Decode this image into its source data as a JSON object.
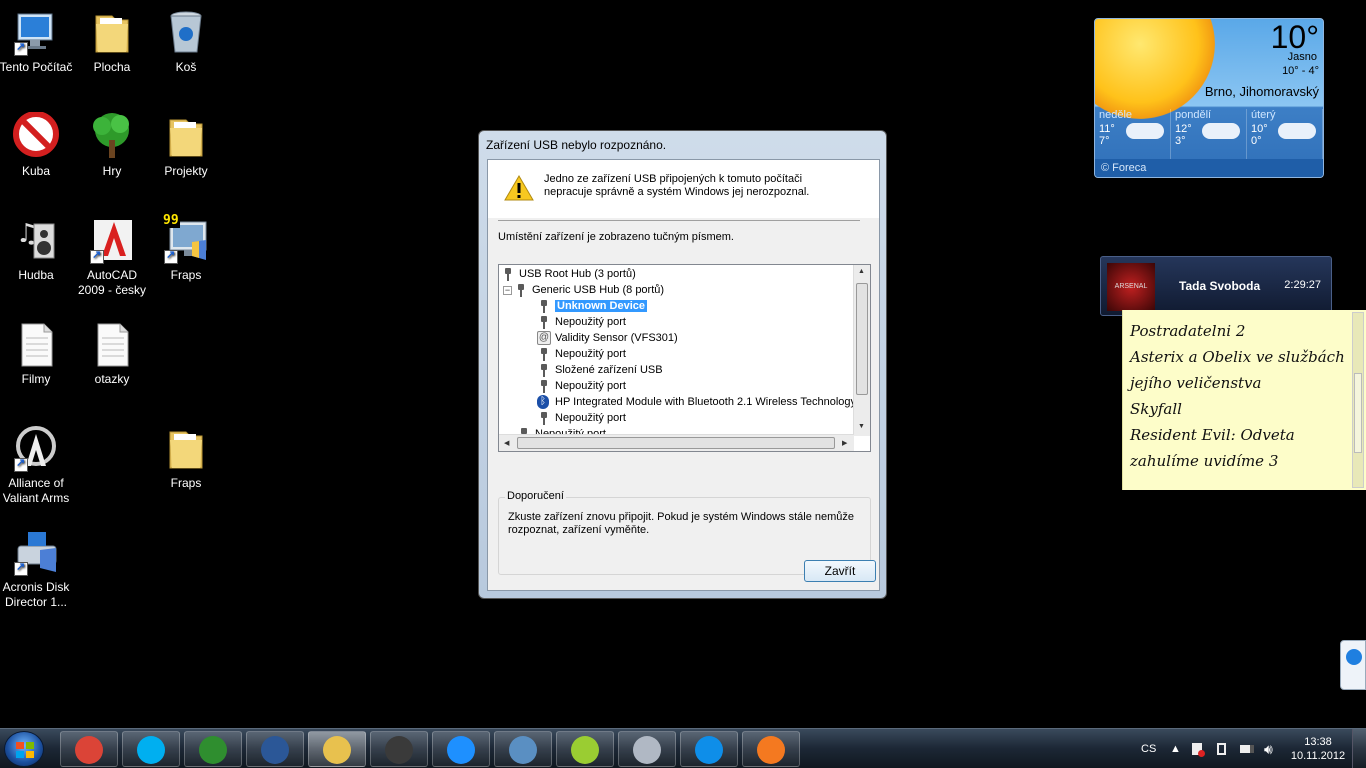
{
  "desktop": {
    "icons": [
      {
        "label": "Tento Počítač",
        "icon": "computer-icon"
      },
      {
        "label": "Plocha",
        "icon": "folder-icon"
      },
      {
        "label": "Koš",
        "icon": "recycle-bin-icon"
      },
      {
        "label": "Kuba",
        "icon": "no-entry-icon"
      },
      {
        "label": "Hry",
        "icon": "tree-icon"
      },
      {
        "label": "Projekty",
        "icon": "folder-icon"
      },
      {
        "label": "Hudba",
        "icon": "music-icon"
      },
      {
        "label": "AutoCAD 2009 - česky",
        "icon": "autocad-icon"
      },
      {
        "label": "Fraps",
        "icon": "fraps-icon"
      },
      {
        "label": "Filmy",
        "icon": "document-icon"
      },
      {
        "label": "otazky",
        "icon": "document-icon"
      },
      {
        "label": "Alliance of Valiant Arms",
        "icon": "ava-icon"
      },
      {
        "label": "Fraps",
        "icon": "folder-icon"
      },
      {
        "label": "Acronis Disk Director 1...",
        "icon": "acronis-icon"
      }
    ],
    "fraps_badge": "99"
  },
  "weather": {
    "temp": "10°",
    "condition": "Jasno",
    "range": "10°  -   4°",
    "city": "Brno, Jihomoravský",
    "days": [
      {
        "name": "neděle",
        "high": "11°",
        "low": "7°"
      },
      {
        "name": "pondělí",
        "high": "12°",
        "low": "3°"
      },
      {
        "name": "úterý",
        "high": "10°",
        "low": "0°"
      }
    ],
    "footer": "© Foreca"
  },
  "notification": {
    "thumb_text": "ARSENAL",
    "name": "Tada Svoboda",
    "time": "2:29:27"
  },
  "sticky_note": {
    "lines": [
      "Postradatelni 2",
      "Asterix a Obelix ve službách",
      "jejího veličenstva",
      "Skyfall",
      "Resident Evil: Odveta",
      "zahulíme uvidíme 3"
    ]
  },
  "dialog": {
    "title": "Zařízení USB nebylo rozpoznáno.",
    "message": "Jedno ze zařízení USB připojených k tomuto počítači nepracuje správně a systém Windows jej nerozpoznal.",
    "location_label": "Umístění zařízení je zobrazeno tučným písmem.",
    "tree": [
      {
        "label": "USB Root Hub (3 portů)",
        "level": 0,
        "expander": ""
      },
      {
        "label": "Generic USB Hub (8 portů)",
        "level": 1,
        "expander": "−"
      },
      {
        "label": "Unknown Device",
        "level": 2,
        "selected": true
      },
      {
        "label": "Nepoužitý port",
        "level": 2
      },
      {
        "label": "Validity Sensor (VFS301)",
        "level": 2,
        "icon": "fingerprint-icon"
      },
      {
        "label": "Nepoužitý port",
        "level": 2
      },
      {
        "label": "Složené zařízení USB",
        "level": 2
      },
      {
        "label": "Nepoužitý port",
        "level": 2
      },
      {
        "label": "HP Integrated Module with Bluetooth 2.1 Wireless Technology",
        "level": 2,
        "icon": "bluetooth-icon"
      },
      {
        "label": "Nepoužitý port",
        "level": 2
      },
      {
        "label": "Nepoužitý port",
        "level": 1
      }
    ],
    "recommendation_title": "Doporučení",
    "recommendation_text": "Zkuste zařízení znovu připojit. Pokud je systém Windows stále nemůže rozpoznat, zařízení vyměňte.",
    "close_button": "Zavřít"
  },
  "taskbar": {
    "apps": [
      {
        "name": "chrome-icon",
        "color": "#db4437"
      },
      {
        "name": "skype-icon",
        "color": "#00aff0"
      },
      {
        "name": "utorrent-icon",
        "color": "#2f8e2f"
      },
      {
        "name": "word-icon",
        "color": "#2b5797"
      },
      {
        "name": "explorer-icon",
        "color": "#e8c14e"
      },
      {
        "name": "steam-icon",
        "color": "#3a3a3a"
      },
      {
        "name": "ie-icon",
        "color": "#1e90ff"
      },
      {
        "name": "bs-player-icon",
        "color": "#5a8fc2"
      },
      {
        "name": "sticky-notes-icon",
        "color": "#9acd32"
      },
      {
        "name": "acronis-icon",
        "color": "#b0b8c4"
      },
      {
        "name": "teamviewer-icon",
        "color": "#0e8ee9"
      },
      {
        "name": "avast-icon",
        "color": "#f47920"
      }
    ],
    "language": "CS",
    "time": "13:38",
    "date": "10.11.2012"
  }
}
